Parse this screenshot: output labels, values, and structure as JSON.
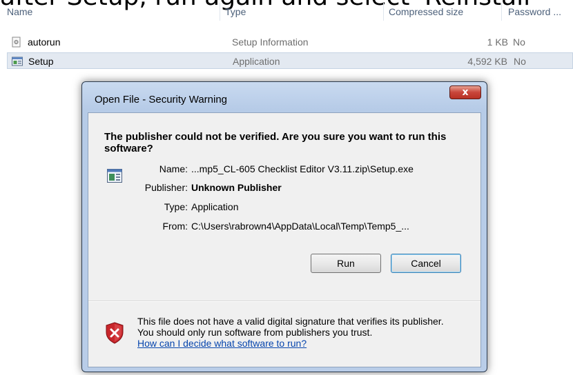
{
  "overlay": {
    "text": "after Setup, run again and select 'Reinstall'"
  },
  "columns": {
    "name": "Name",
    "type": "Type",
    "compressed_size": "Compressed size",
    "password": "Password ..."
  },
  "files": [
    {
      "name": "autorun",
      "type": "Setup Information",
      "size": "1 KB",
      "password": "No",
      "icon": "settings-file-icon"
    },
    {
      "name": "Setup",
      "type": "Application",
      "size": "4,592 KB",
      "password": "No",
      "icon": "application-icon"
    }
  ],
  "dialog": {
    "title": "Open File - Security Warning",
    "close_label": "x",
    "heading": "The publisher could not be verified.  Are you sure you want to run this software?",
    "fields": [
      {
        "label": "Name:",
        "value": "...mp5_CL-605 Checklist Editor V3.11.zip\\Setup.exe"
      },
      {
        "label": "Publisher:",
        "value": "Unknown Publisher"
      },
      {
        "label": "Type:",
        "value": "Application"
      },
      {
        "label": "From:",
        "value": "C:\\Users\\rabrown4\\AppData\\Local\\Temp\\Temp5_..."
      }
    ],
    "run_label": "Run",
    "cancel_label": "Cancel",
    "warning_text": "This file does not have a valid digital signature that verifies its publisher.  You should only run software from publishers you trust.",
    "help_link": "How can I decide what software to run?"
  },
  "colors": {
    "accent_link": "#0645ad",
    "dialog_frame": "#b9cde8",
    "shield_red": "#c8262b"
  }
}
